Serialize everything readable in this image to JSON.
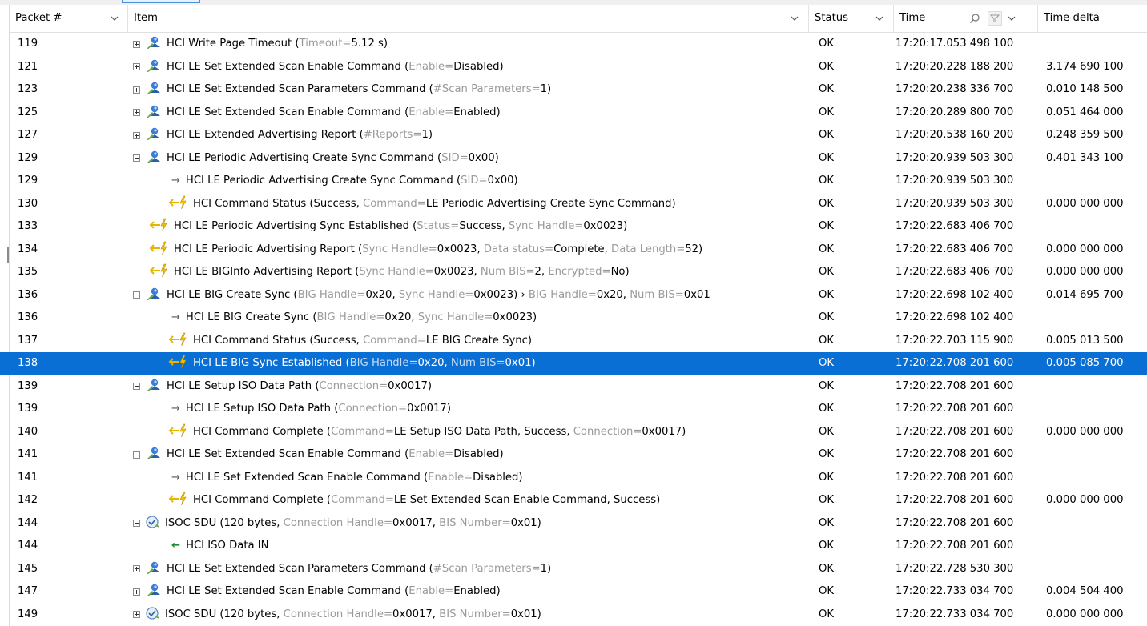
{
  "columns": {
    "packet": "Packet #",
    "item": "Item",
    "status": "Status",
    "time": "Time",
    "delta": "Time delta"
  },
  "icons": {
    "command": "hci-command-icon",
    "event": "hci-event-icon",
    "isoc": "isoc-sdu-icon",
    "outgoing": "right-arrow-icon",
    "incoming": "left-arrow-icon",
    "expand": "expand-icon",
    "collapse": "collapse-icon"
  },
  "colors": {
    "selection": "#0a6fd4",
    "param_name": "#9a9a9a",
    "data_in_arrow": "#1f8a2a",
    "event_bolt": "#e8b400"
  },
  "rows": [
    {
      "num": "119",
      "indent": 0,
      "toggle": "plus",
      "icon": "command",
      "parts": [
        [
          "HCI Write Page Timeout (",
          0
        ],
        [
          "Timeout=",
          1
        ],
        [
          "5.12 s)",
          0
        ]
      ],
      "status": "OK",
      "time": "17:20:17.053 498 100",
      "delta": ""
    },
    {
      "num": "121",
      "indent": 0,
      "toggle": "plus",
      "icon": "command",
      "parts": [
        [
          "HCI LE Set Extended Scan Enable Command (",
          0
        ],
        [
          "Enable=",
          1
        ],
        [
          "Disabled)",
          0
        ]
      ],
      "status": "OK",
      "time": "17:20:20.228 188 200",
      "delta": "3.174 690 100"
    },
    {
      "num": "123",
      "indent": 0,
      "toggle": "plus",
      "icon": "command",
      "parts": [
        [
          "HCI LE Set Extended Scan Parameters Command (",
          0
        ],
        [
          "#Scan Parameters=",
          1
        ],
        [
          "1)",
          0
        ]
      ],
      "status": "OK",
      "time": "17:20:20.238 336 700",
      "delta": "0.010 148 500"
    },
    {
      "num": "125",
      "indent": 0,
      "toggle": "plus",
      "icon": "command",
      "parts": [
        [
          "HCI LE Set Extended Scan Enable Command (",
          0
        ],
        [
          "Enable=",
          1
        ],
        [
          "Enabled)",
          0
        ]
      ],
      "status": "OK",
      "time": "17:20:20.289 800 700",
      "delta": "0.051 464 000"
    },
    {
      "num": "127",
      "indent": 0,
      "toggle": "plus",
      "icon": "command",
      "parts": [
        [
          "HCI LE Extended Advertising Report (",
          0
        ],
        [
          "#Reports=",
          1
        ],
        [
          "1)",
          0
        ]
      ],
      "status": "OK",
      "time": "17:20:20.538 160 200",
      "delta": "0.248 359 500"
    },
    {
      "num": "129",
      "indent": 0,
      "toggle": "minus",
      "icon": "command",
      "parts": [
        [
          "HCI LE Periodic Advertising Create Sync Command (",
          0
        ],
        [
          "SID=",
          1
        ],
        [
          "0x00)",
          0
        ]
      ],
      "status": "OK",
      "time": "17:20:20.939 503 300",
      "delta": "0.401 343 100"
    },
    {
      "num": "129",
      "indent": 1,
      "toggle": "",
      "icon": "outgoing",
      "parts": [
        [
          "HCI LE Periodic Advertising Create Sync Command (",
          0
        ],
        [
          "SID=",
          1
        ],
        [
          "0x00)",
          0
        ]
      ],
      "status": "OK",
      "time": "17:20:20.939 503 300",
      "delta": ""
    },
    {
      "num": "130",
      "indent": 1,
      "toggle": "",
      "icon": "event",
      "parts": [
        [
          "HCI Command Status (Success, ",
          0
        ],
        [
          "Command=",
          1
        ],
        [
          "LE Periodic Advertising Create Sync Command)",
          0
        ]
      ],
      "status": "OK",
      "time": "17:20:20.939 503 300",
      "delta": "0.000 000 000"
    },
    {
      "num": "133",
      "indent": -1,
      "toggle": "",
      "icon": "event",
      "parts": [
        [
          "HCI LE Periodic Advertising Sync Established (",
          0
        ],
        [
          "Status=",
          1
        ],
        [
          "Success, ",
          0
        ],
        [
          "Sync Handle=",
          1
        ],
        [
          "0x0023)",
          0
        ]
      ],
      "status": "OK",
      "time": "17:20:22.683 406 700",
      "delta": ""
    },
    {
      "num": "134",
      "indent": -1,
      "toggle": "",
      "icon": "event",
      "parts": [
        [
          "HCI LE Periodic Advertising Report (",
          0
        ],
        [
          "Sync Handle=",
          1
        ],
        [
          "0x0023, ",
          0
        ],
        [
          "Data status=",
          1
        ],
        [
          "Complete, ",
          0
        ],
        [
          "Data Length=",
          1
        ],
        [
          "52)",
          0
        ]
      ],
      "status": "OK",
      "time": "17:20:22.683 406 700",
      "delta": "0.000 000 000"
    },
    {
      "num": "135",
      "indent": -1,
      "toggle": "",
      "icon": "event",
      "parts": [
        [
          "HCI LE BIGInfo Advertising Report (",
          0
        ],
        [
          "Sync Handle=",
          1
        ],
        [
          "0x0023, ",
          0
        ],
        [
          "Num BIS=",
          1
        ],
        [
          "2, ",
          0
        ],
        [
          "Encrypted=",
          1
        ],
        [
          "No)",
          0
        ]
      ],
      "status": "OK",
      "time": "17:20:22.683 406 700",
      "delta": "0.000 000 000"
    },
    {
      "num": "136",
      "indent": 0,
      "toggle": "minus",
      "icon": "command",
      "parts": [
        [
          "HCI LE BIG Create Sync (",
          0
        ],
        [
          "BIG Handle=",
          1
        ],
        [
          "0x20, ",
          0
        ],
        [
          "Sync Handle=",
          1
        ],
        [
          "0x0023) › ",
          0
        ],
        [
          "BIG Handle=",
          1
        ],
        [
          "0x20, ",
          0
        ],
        [
          "Num BIS=",
          1
        ],
        [
          "0x01",
          0
        ]
      ],
      "status": "OK",
      "time": "17:20:22.698 102 400",
      "delta": "0.014 695 700"
    },
    {
      "num": "136",
      "indent": 1,
      "toggle": "",
      "icon": "outgoing",
      "parts": [
        [
          "HCI LE BIG Create Sync (",
          0
        ],
        [
          "BIG Handle=",
          1
        ],
        [
          "0x20, ",
          0
        ],
        [
          "Sync Handle=",
          1
        ],
        [
          "0x0023)",
          0
        ]
      ],
      "status": "OK",
      "time": "17:20:22.698 102 400",
      "delta": ""
    },
    {
      "num": "137",
      "indent": 1,
      "toggle": "",
      "icon": "event",
      "parts": [
        [
          "HCI Command Status (Success, ",
          0
        ],
        [
          "Command=",
          1
        ],
        [
          "LE BIG Create Sync)",
          0
        ]
      ],
      "status": "OK",
      "time": "17:20:22.703 115 900",
      "delta": "0.005 013 500"
    },
    {
      "num": "138",
      "indent": 1,
      "toggle": "",
      "icon": "event",
      "selected": true,
      "parts": [
        [
          "HCI LE BIG Sync Established (",
          0
        ],
        [
          "BIG Handle=",
          1
        ],
        [
          "0x20, ",
          0
        ],
        [
          "Num BIS=",
          1
        ],
        [
          "0x01)",
          0
        ]
      ],
      "status": "OK",
      "time": "17:20:22.708 201 600",
      "delta": "0.005 085 700"
    },
    {
      "num": "139",
      "indent": 0,
      "toggle": "minus",
      "icon": "command",
      "parts": [
        [
          "HCI LE Setup ISO Data Path (",
          0
        ],
        [
          "Connection=",
          1
        ],
        [
          "0x0017)",
          0
        ]
      ],
      "status": "OK",
      "time": "17:20:22.708 201 600",
      "delta": ""
    },
    {
      "num": "139",
      "indent": 1,
      "toggle": "",
      "icon": "outgoing",
      "parts": [
        [
          "HCI LE Setup ISO Data Path (",
          0
        ],
        [
          "Connection=",
          1
        ],
        [
          "0x0017)",
          0
        ]
      ],
      "status": "OK",
      "time": "17:20:22.708 201 600",
      "delta": ""
    },
    {
      "num": "140",
      "indent": 1,
      "toggle": "",
      "icon": "event",
      "parts": [
        [
          "HCI Command Complete (",
          0
        ],
        [
          "Command=",
          1
        ],
        [
          "LE Setup ISO Data Path, Success, ",
          0
        ],
        [
          "Connection=",
          1
        ],
        [
          "0x0017)",
          0
        ]
      ],
      "status": "OK",
      "time": "17:20:22.708 201 600",
      "delta": "0.000 000 000"
    },
    {
      "num": "141",
      "indent": 0,
      "toggle": "minus",
      "icon": "command",
      "parts": [
        [
          "HCI LE Set Extended Scan Enable Command (",
          0
        ],
        [
          "Enable=",
          1
        ],
        [
          "Disabled)",
          0
        ]
      ],
      "status": "OK",
      "time": "17:20:22.708 201 600",
      "delta": ""
    },
    {
      "num": "141",
      "indent": 1,
      "toggle": "",
      "icon": "outgoing",
      "parts": [
        [
          "HCI LE Set Extended Scan Enable Command (",
          0
        ],
        [
          "Enable=",
          1
        ],
        [
          "Disabled)",
          0
        ]
      ],
      "status": "OK",
      "time": "17:20:22.708 201 600",
      "delta": ""
    },
    {
      "num": "142",
      "indent": 1,
      "toggle": "",
      "icon": "event",
      "parts": [
        [
          "HCI Command Complete (",
          0
        ],
        [
          "Command=",
          1
        ],
        [
          "LE Set Extended Scan Enable Command, Success)",
          0
        ]
      ],
      "status": "OK",
      "time": "17:20:22.708 201 600",
      "delta": "0.000 000 000"
    },
    {
      "num": "144",
      "indent": 0,
      "toggle": "minus",
      "icon": "isoc",
      "parts": [
        [
          "ISOC SDU (120 bytes, ",
          0
        ],
        [
          "Connection Handle=",
          1
        ],
        [
          "0x0017, ",
          0
        ],
        [
          "BIS Number=",
          1
        ],
        [
          "0x01)",
          0
        ]
      ],
      "status": "OK",
      "time": "17:20:22.708 201 600",
      "delta": ""
    },
    {
      "num": "144",
      "indent": 1,
      "toggle": "",
      "icon": "incoming",
      "parts": [
        [
          "HCI ISO Data IN",
          0
        ]
      ],
      "status": "OK",
      "time": "17:20:22.708 201 600",
      "delta": ""
    },
    {
      "num": "145",
      "indent": 0,
      "toggle": "plus",
      "icon": "command",
      "parts": [
        [
          "HCI LE Set Extended Scan Parameters Command (",
          0
        ],
        [
          "#Scan Parameters=",
          1
        ],
        [
          "1)",
          0
        ]
      ],
      "status": "OK",
      "time": "17:20:22.728 530 300",
      "delta": ""
    },
    {
      "num": "147",
      "indent": 0,
      "toggle": "plus",
      "icon": "command",
      "parts": [
        [
          "HCI LE Set Extended Scan Enable Command (",
          0
        ],
        [
          "Enable=",
          1
        ],
        [
          "Enabled)",
          0
        ]
      ],
      "status": "OK",
      "time": "17:20:22.733 034 700",
      "delta": "0.004 504 400"
    },
    {
      "num": "149",
      "indent": 0,
      "toggle": "plus",
      "icon": "isoc",
      "parts": [
        [
          "ISOC SDU (120 bytes, ",
          0
        ],
        [
          "Connection Handle=",
          1
        ],
        [
          "0x0017, ",
          0
        ],
        [
          "BIS Number=",
          1
        ],
        [
          "0x01)",
          0
        ]
      ],
      "status": "OK",
      "time": "17:20:22.733 034 700",
      "delta": "0.000 000 000"
    }
  ]
}
